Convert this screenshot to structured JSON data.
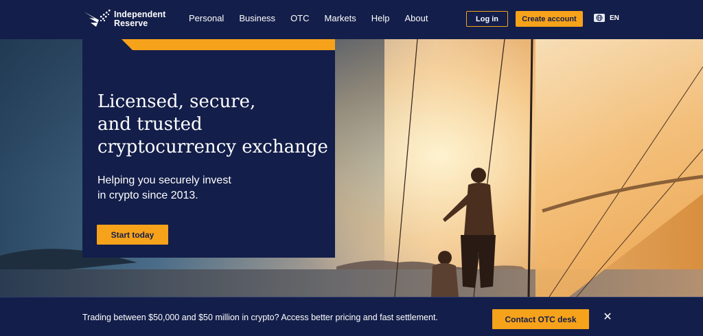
{
  "brand": {
    "line1": "Independent",
    "line2": "Reserve"
  },
  "nav": {
    "items": [
      {
        "label": "Personal"
      },
      {
        "label": "Business"
      },
      {
        "label": "OTC"
      },
      {
        "label": "Markets"
      },
      {
        "label": "Help"
      },
      {
        "label": "About"
      }
    ],
    "login_label": "Log in",
    "create_label": "Create account",
    "language": {
      "icon": "globe-icon",
      "label": "EN"
    }
  },
  "hero": {
    "headline_lines": [
      "Licensed, secure,",
      "and trusted",
      "cryptocurrency exchange"
    ],
    "subhead_lines": [
      "Helping you securely invest",
      "in crypto since 2013."
    ],
    "cta_label": "Start today"
  },
  "banner": {
    "text": "Trading between $50,000 and $50 million in crypto? Access better pricing and fast settlement.",
    "cta_label": "Contact OTC desk",
    "close_icon": "close-icon"
  },
  "colors": {
    "navy": "#131e4a",
    "accent": "#f7a21b"
  }
}
